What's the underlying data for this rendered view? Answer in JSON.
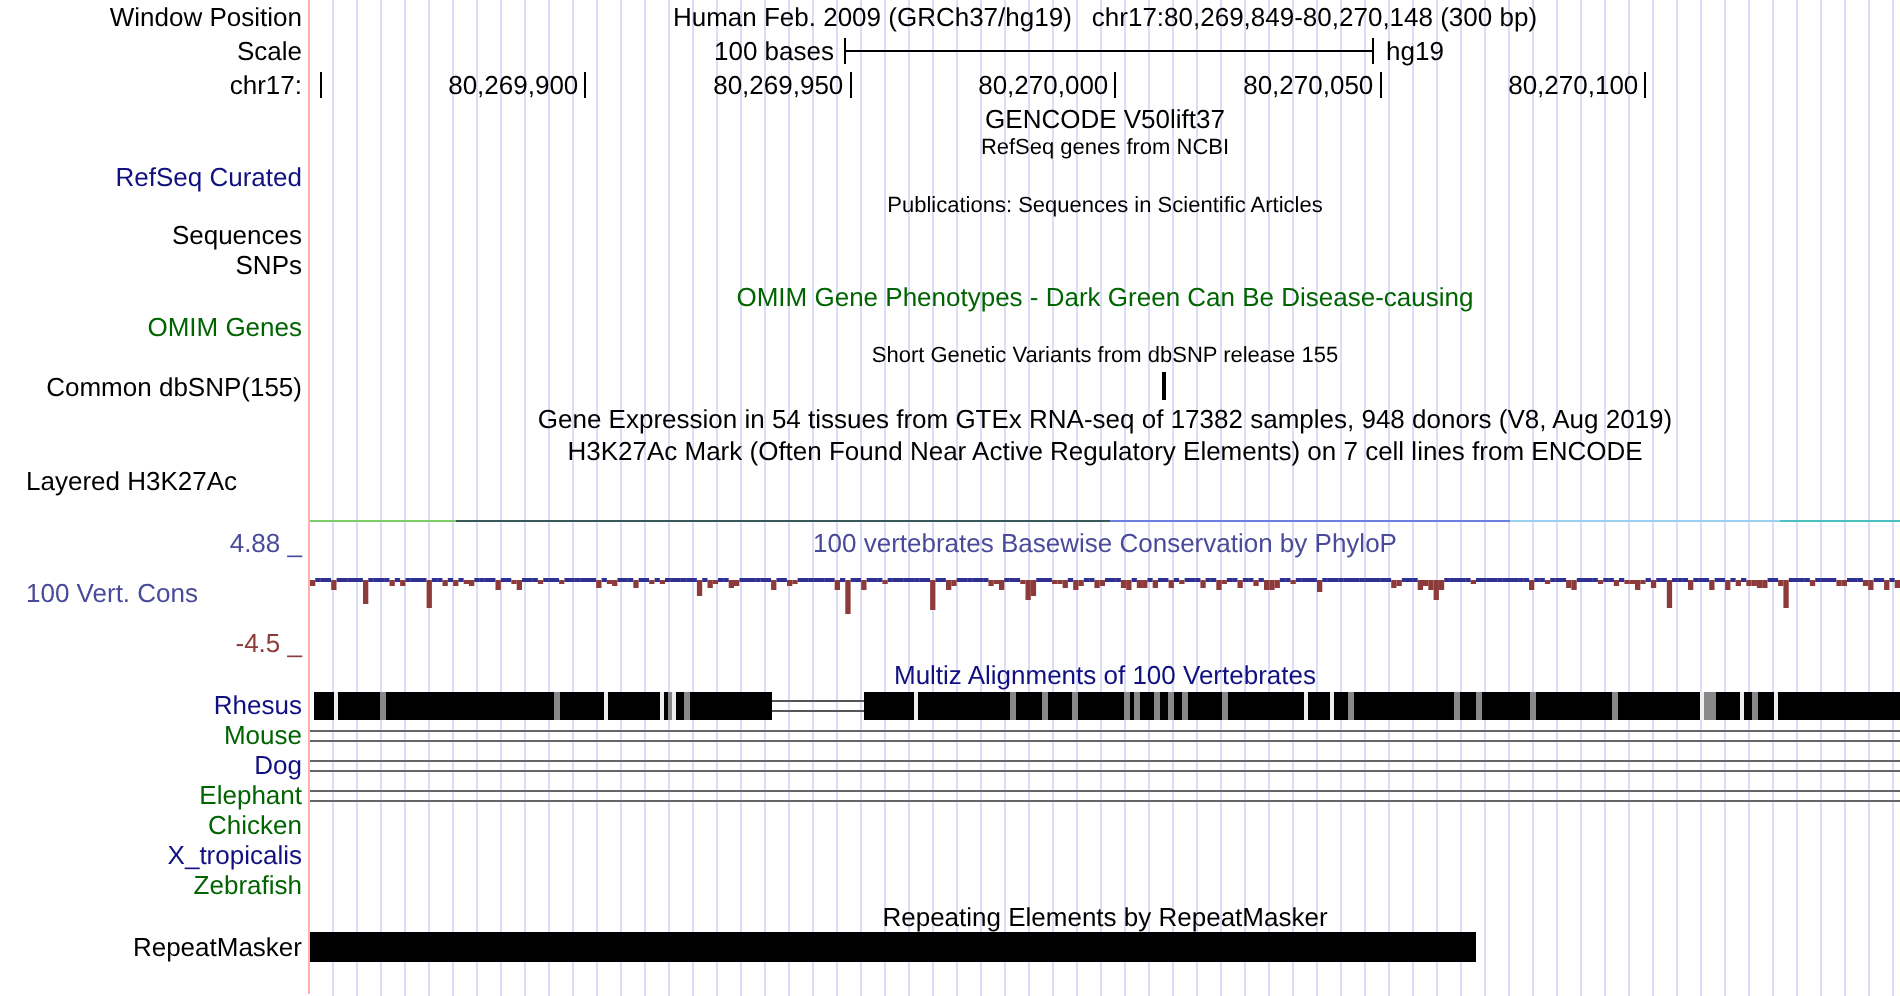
{
  "header": {
    "position_label": "Window Position",
    "assembly_text": "Human Feb. 2009 (GRCh37/hg19)",
    "position_text": "chr17:80,269,849-80,270,148 (300 bp)",
    "scale_label": "Scale",
    "scale_text": "100 bases",
    "scale_assembly": "hg19",
    "chrom_label": "chr17:",
    "ruler_labels": [
      "80,269,900",
      "80,269,950",
      "80,270,000",
      "80,270,050",
      "80,270,100"
    ]
  },
  "tracks": [
    {
      "kind": "title",
      "title": "GENCODE V50lift37",
      "color": "#000000"
    },
    {
      "kind": "small_title",
      "title": "RefSeq genes from NCBI",
      "color": "#000000"
    },
    {
      "kind": "label",
      "label": "RefSeq Curated",
      "color": "#101080"
    },
    {
      "kind": "small_title",
      "title": "Publications: Sequences in Scientific Articles",
      "color": "#000000"
    },
    {
      "kind": "label",
      "label": "Sequences",
      "color": "#000000"
    },
    {
      "kind": "label",
      "label": "SNPs",
      "color": "#000000"
    },
    {
      "kind": "title",
      "title": "OMIM Gene Phenotypes - Dark Green Can Be Disease-causing",
      "color": "#006400"
    },
    {
      "kind": "label",
      "label": "OMIM Genes",
      "color": "#006400"
    },
    {
      "kind": "small_title",
      "title": "Short Genetic Variants from dbSNP release 155",
      "color": "#000000"
    },
    {
      "kind": "marker",
      "label": "Common dbSNP(155)",
      "color": "#000000"
    },
    {
      "kind": "title",
      "title": "Gene Expression in 54 tissues from GTEx RNA-seq of 17382 samples, 948 donors (V8, Aug 2019)",
      "color": "#000000"
    },
    {
      "kind": "title",
      "title": "H3K27Ac Mark (Often Found Near Active Regulatory Elements) on 7 cell lines from ENCODE",
      "color": "#000000"
    },
    {
      "kind": "layered",
      "label": "Layered H3K27Ac",
      "color": "#000000"
    }
  ],
  "phylop": {
    "upper": "4.88 _",
    "label": "100 Vert. Cons",
    "lower": "-4.5 _",
    "title": "100 vertebrates Basewise Conservation by PhyloP"
  },
  "multiz": {
    "title": "Multiz Alignments of 100 Vertebrates",
    "species": [
      {
        "name": "Rhesus",
        "color": "#101080",
        "kind": "blocks"
      },
      {
        "name": "Mouse",
        "color": "#006400",
        "kind": "lines"
      },
      {
        "name": "Dog",
        "color": "#101080",
        "kind": "lines"
      },
      {
        "name": "Elephant",
        "color": "#006400",
        "kind": "lines"
      },
      {
        "name": "Chicken",
        "color": "#006400",
        "kind": "none"
      },
      {
        "name": "X_tropicalis",
        "color": "#101080",
        "kind": "none"
      },
      {
        "name": "Zebrafish",
        "color": "#006400",
        "kind": "none"
      }
    ]
  },
  "repeats": {
    "title": "Repeating Elements by RepeatMasker",
    "label": "RepeatMasker"
  }
}
